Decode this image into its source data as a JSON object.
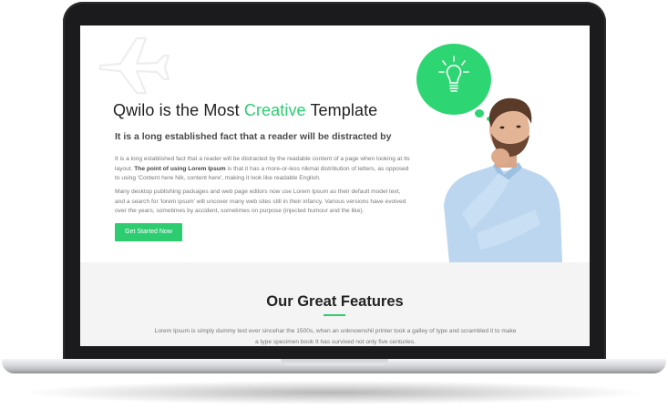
{
  "hero": {
    "title_pre": "Qwilo is the Most ",
    "title_accent": "Creative",
    "title_post": " Template",
    "subtitle": "It is a long established fact that a reader will be distracted by",
    "para1_a": "It is a long established fact that a reader will be distracted by the readable content of a page when looking at its layout. ",
    "para1_bold": "The point of using Lorem Ipsum",
    "para1_b": " is that it has a more-or-less nikmal distribution of letters, as opposed to using 'Content here Nik, content here', making it look like readable English.",
    "para2": "Many desktop publishing packages and web page editors now use Lorem Ipsum as their default model text, and a search for 'lorem ipsum' will uncover many web sites still in their infancy. Various versions have evolved over the years, sometimes by accident, sometimes on purpose (injected humour and the like).",
    "cta_label": "Get Started Now"
  },
  "features": {
    "title": "Our Great Features",
    "text": "Lorem Ipsum is simply dummy text ever sincehar the 1500s, when an unknownshil printer took a galley of type and scrambled it to make a type specimen book It has survived not only five centuries."
  },
  "colors": {
    "accent": "#2ecc71",
    "bubble": "#2ed573",
    "laptop_frame": "#1b1b1d"
  },
  "icons": [
    "plane-icon",
    "lightbulb-icon"
  ]
}
